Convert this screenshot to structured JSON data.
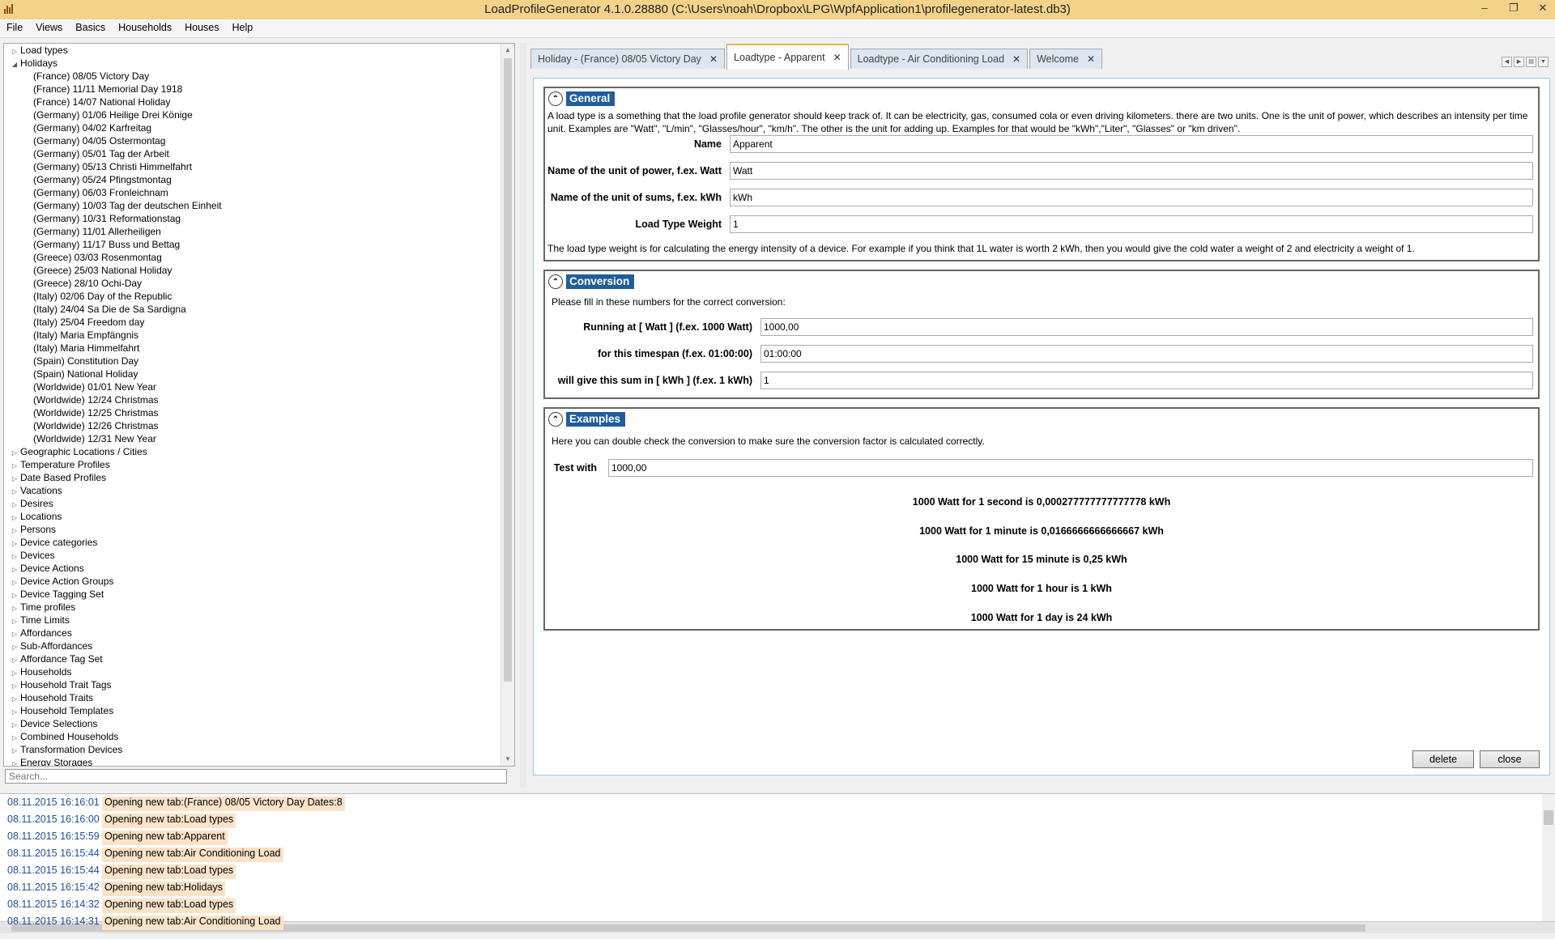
{
  "window": {
    "title": "LoadProfileGenerator 4.1.0.28880 (C:\\Users\\noah\\Dropbox\\LPG\\WpfApplication1\\profilegenerator-latest.db3)",
    "minimize": "‒",
    "restore": "❐",
    "close": "✕"
  },
  "menu": [
    "File",
    "Views",
    "Basics",
    "Households",
    "Houses",
    "Help"
  ],
  "tree": {
    "load_types": "Load types",
    "holidays": "Holidays",
    "holiday_items": [
      "(France) 08/05 Victory Day",
      "(France) 11/11 Memorial Day 1918",
      "(France) 14/07 National Holiday",
      "(Germany) 01/06 Heilige Drei Könige",
      "(Germany) 04/02 Karfreitag",
      "(Germany) 04/05 Ostermontag",
      "(Germany) 05/01 Tag der Arbeit",
      "(Germany) 05/13 Christi Himmelfahrt",
      "(Germany) 05/24 Pfingstmontag",
      "(Germany) 06/03 Fronleichnam",
      "(Germany) 10/03 Tag der deutschen Einheit",
      "(Germany) 10/31 Reformationstag",
      "(Germany) 11/01 Allerheiligen",
      "(Germany) 11/17 Buss und Bettag",
      "(Greece) 03/03 Rosenmontag",
      "(Greece) 25/03 National Holiday",
      "(Greece) 28/10 Ochi-Day",
      "(Italy) 02/06 Day of the Republic",
      "(Italy) 24/04 Sa Die de Sa Sardigna",
      "(Italy) 25/04 Freedom day",
      "(Italy) Maria Empfängnis",
      "(Italy) Maria Himmelfahrt",
      "(Spain) Constitution Day",
      "(Spain) National Holiday",
      "(Worldwide) 01/01 New Year",
      "(Worldwide) 12/24 Christmas",
      "(Worldwide) 12/25 Christmas",
      "(Worldwide) 12/26 Christmas",
      "(Worldwide) 12/31 New Year"
    ],
    "categories": [
      "Geographic Locations / Cities",
      "Temperature Profiles",
      "Date Based Profiles",
      "Vacations",
      "Desires",
      "Locations",
      "Persons",
      "Device categories",
      "Devices",
      "Device Actions",
      "Device Action Groups",
      "Device Tagging Set",
      "Time profiles",
      "Time Limits",
      "Affordances",
      "Sub-Affordances",
      "Affordance Tag Set",
      "Households",
      "Household Trait Tags",
      "Household Traits",
      "Household Templates",
      "Device Selections",
      "Combined Households",
      "Transformation Devices",
      "Energy Storages"
    ],
    "search_placeholder": "Search..."
  },
  "tabs": [
    {
      "label": "Holiday - (France) 08/05 Victory Day",
      "active": false
    },
    {
      "label": "Loadtype - Apparent",
      "active": true
    },
    {
      "label": "Loadtype - Air Conditioning Load",
      "active": false
    },
    {
      "label": "Welcome",
      "active": false
    }
  ],
  "general": {
    "title": "General",
    "description": "A load type is a something that the load profile generator should keep track of. It can be electricity, gas, consumed cola or even driving kilometers. there are two units. One is the unit of power, which describes an intensity per time unit. Examples are \"Watt\", \"L/min\", \"Glasses/hour\", \"km/h\". The other is the unit for adding up. Examples for that would be \"kWh\",\"Liter\", \"Glasses\" or \"km driven\".",
    "name_label": "Name",
    "name_value": "Apparent",
    "power_label": "Name of the unit of power, f.ex. Watt",
    "power_value": "Watt",
    "sum_label": "Name of the unit of sums, f.ex. kWh",
    "sum_value": "kWh",
    "weight_label": "Load Type Weight",
    "weight_value": "1",
    "weight_note": "The load type weight is for calculating the energy intensity of a device. For example if you think that 1L water is worth 2 kWh, then you would give the cold water a weight of 2 and electricity a weight of 1."
  },
  "conversion": {
    "title": "Conversion",
    "intro": "Please fill in these numbers for the correct conversion:",
    "running_label": "Running at [   Watt   ] (f.ex. 1000 Watt)",
    "running_value": "1000,00",
    "timespan_label": "for this timespan (f.ex. 01:00:00)",
    "timespan_value": "01:00:00",
    "sum_label": "will give this sum in [   kWh   ] (f.ex. 1 kWh)",
    "sum_value": "1"
  },
  "examples": {
    "title": "Examples",
    "intro": "Here you can double check the conversion to make sure the conversion factor is calculated correctly.",
    "test_label": "Test with",
    "test_value": "1000,00",
    "lines": [
      "1000 Watt for 1 second is 0,000277777777777778 kWh",
      "1000 Watt for 1 minute is 0,0166666666666667 kWh",
      "1000 Watt for 15 minute is 0,25 kWh",
      "1000 Watt for 1 hour is 1 kWh",
      "1000 Watt for 1 day is 24 kWh"
    ]
  },
  "buttons": {
    "delete": "delete",
    "close": "close"
  },
  "log": [
    {
      "time": "08.11.2015 16:16:01",
      "msg": "Opening new tab:(France) 08/05 Victory Day   Dates:8"
    },
    {
      "time": "08.11.2015 16:16:00",
      "msg": "Opening new tab:Load types"
    },
    {
      "time": "08.11.2015 16:15:59",
      "msg": "Opening new tab:Apparent"
    },
    {
      "time": "08.11.2015 16:15:44",
      "msg": "Opening new tab:Air Conditioning Load"
    },
    {
      "time": "08.11.2015 16:15:44",
      "msg": "Opening new tab:Load types"
    },
    {
      "time": "08.11.2015 16:15:42",
      "msg": "Opening new tab:Holidays"
    },
    {
      "time": "08.11.2015 16:14:32",
      "msg": "Opening new tab:Load types"
    },
    {
      "time": "08.11.2015 16:14:31",
      "msg": "Opening new tab:Air Conditioning Load"
    }
  ]
}
